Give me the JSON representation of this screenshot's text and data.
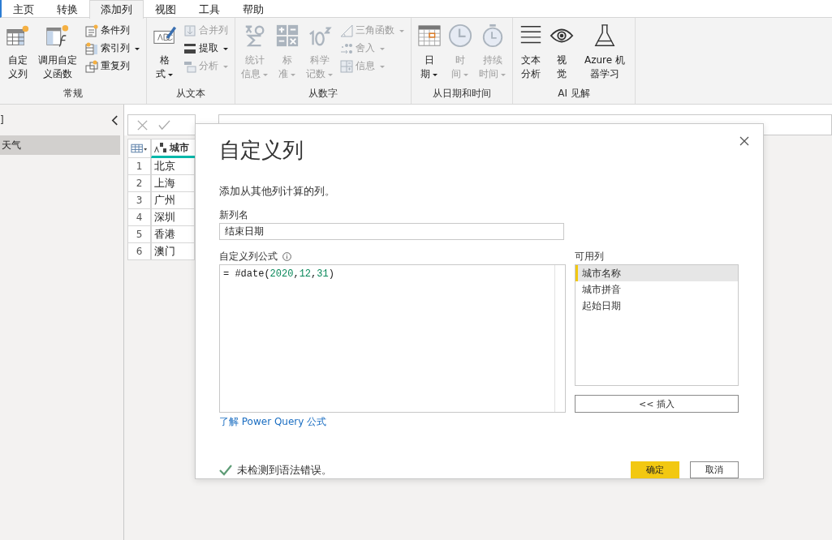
{
  "tabs": [
    {
      "label": "主页",
      "selected": false
    },
    {
      "label": "转换",
      "selected": false
    },
    {
      "label": "添加列",
      "selected": true
    },
    {
      "label": "视图",
      "selected": false
    },
    {
      "label": "工具",
      "selected": false
    },
    {
      "label": "帮助",
      "selected": false
    }
  ],
  "ribbon": {
    "groups": [
      {
        "label": "常规",
        "items": [
          {
            "kind": "large",
            "label": "自定义列",
            "disabled": false,
            "dropdown": false
          },
          {
            "kind": "large",
            "label": "调用自定义函数",
            "disabled": false,
            "dropdown": false
          },
          {
            "kind": "small",
            "label": "条件列",
            "disabled": false,
            "dropdown": false
          },
          {
            "kind": "small",
            "label": "索引列",
            "disabled": false,
            "dropdown": true
          },
          {
            "kind": "small",
            "label": "重复列",
            "disabled": false,
            "dropdown": false
          }
        ]
      },
      {
        "label": "从文本",
        "items": [
          {
            "kind": "large",
            "label": "格式",
            "disabled": false,
            "dropdown": true
          },
          {
            "kind": "small",
            "label": "合并列",
            "disabled": true,
            "dropdown": false
          },
          {
            "kind": "small",
            "label": "提取",
            "disabled": false,
            "dropdown": true
          },
          {
            "kind": "small",
            "label": "分析",
            "disabled": true,
            "dropdown": true
          }
        ]
      },
      {
        "label": "从数字",
        "items": [
          {
            "kind": "large",
            "label": "统计信息",
            "disabled": true,
            "dropdown": true
          },
          {
            "kind": "large",
            "label": "标准",
            "disabled": true,
            "dropdown": true
          },
          {
            "kind": "large",
            "label": "科学记数",
            "disabled": true,
            "dropdown": true
          },
          {
            "kind": "small",
            "label": "三角函数",
            "disabled": true,
            "dropdown": true
          },
          {
            "kind": "small",
            "label": "舍入",
            "disabled": true,
            "dropdown": true
          },
          {
            "kind": "small",
            "label": "信息",
            "disabled": true,
            "dropdown": true
          }
        ]
      },
      {
        "label": "从日期和时间",
        "items": [
          {
            "kind": "large",
            "label": "日期",
            "disabled": false,
            "dropdown": true
          },
          {
            "kind": "large",
            "label": "时间",
            "disabled": true,
            "dropdown": true
          },
          {
            "kind": "large",
            "label": "持续时间",
            "disabled": true,
            "dropdown": true
          }
        ]
      },
      {
        "label": "AI 见解",
        "items": [
          {
            "kind": "large",
            "label": "文本分析",
            "disabled": false,
            "dropdown": false
          },
          {
            "kind": "large",
            "label": "视觉",
            "disabled": false,
            "dropdown": false
          },
          {
            "kind": "large",
            "label": "Azure 机器学习",
            "disabled": false,
            "dropdown": false
          }
        ]
      }
    ]
  },
  "queries_pane": {
    "header": "]",
    "items": [
      {
        "label": "天气",
        "selected": true
      }
    ]
  },
  "table": {
    "columns": [
      "城市"
    ],
    "rows": [
      {
        "index": "1",
        "cells": [
          "北京"
        ]
      },
      {
        "index": "2",
        "cells": [
          "上海"
        ]
      },
      {
        "index": "3",
        "cells": [
          "广州"
        ]
      },
      {
        "index": "4",
        "cells": [
          "深圳"
        ]
      },
      {
        "index": "5",
        "cells": [
          "香港"
        ]
      },
      {
        "index": "6",
        "cells": [
          "澳门"
        ]
      }
    ]
  },
  "dialog": {
    "title": "自定义列",
    "description": "添加从其他列计算的列。",
    "name_label": "新列名",
    "name_value": "结束日期",
    "formula_label": "自定义列公式",
    "formula": [
      {
        "kind": "plain",
        "text": "= #date("
      },
      {
        "kind": "number",
        "text": "2020"
      },
      {
        "kind": "plain",
        "text": ","
      },
      {
        "kind": "number",
        "text": "12"
      },
      {
        "kind": "plain",
        "text": ","
      },
      {
        "kind": "number",
        "text": "31"
      },
      {
        "kind": "plain",
        "text": ")"
      }
    ],
    "help_link": "了解 Power Query 公式",
    "columns_label": "可用列",
    "columns": [
      {
        "label": "城市名称",
        "selected": true
      },
      {
        "label": "城市拼音",
        "selected": false
      },
      {
        "label": "起始日期",
        "selected": false
      }
    ],
    "insert_button": "<< 插入",
    "status": "未检测到语法错误。",
    "ok_button": "确定",
    "cancel_button": "取消"
  }
}
